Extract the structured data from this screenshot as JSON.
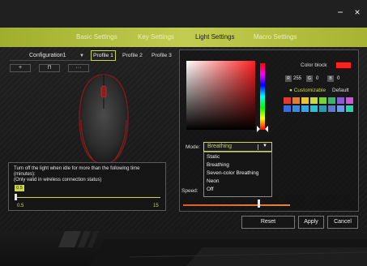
{
  "window": {
    "minimize_symbol": "−",
    "close_symbol": "×"
  },
  "nav": {
    "items": [
      {
        "label": "Basic Settings",
        "active": false
      },
      {
        "label": "Key Settings",
        "active": false
      },
      {
        "label": "Light Settings",
        "active": true
      },
      {
        "label": "Macro Settings",
        "active": false
      }
    ]
  },
  "config": {
    "value": "Configuration1",
    "arrow": "▼"
  },
  "profiles": [
    {
      "label": "Profile 1",
      "active": true
    },
    {
      "label": "Profile 2",
      "active": false
    },
    {
      "label": "Profile 3",
      "active": false
    }
  ],
  "small_buttons": [
    {
      "label": "+"
    },
    {
      "label": "⊓"
    },
    {
      "label": "···"
    }
  ],
  "idle": {
    "text": "Turn off the light when idle for more than the following time\n(minutes):\n(Only valid in wireless connection status)",
    "value": "0.5",
    "min_label": "0.5",
    "max_label": "15",
    "min": 0.5,
    "max": 15
  },
  "color": {
    "label": "Color block",
    "current": "#ff2020",
    "r_key": "R",
    "r": "255",
    "g_key": "G",
    "g": "0",
    "b_key": "B",
    "b": "0",
    "customizable_label": "● Customizable",
    "default_label": "Default",
    "swatch_rows": [
      [
        "#e23a2e",
        "#e8792e",
        "#e8c23a",
        "#c8d84a",
        "#7ad23a",
        "#3ab46a",
        "#8a5ad2",
        "#c85ad2"
      ],
      [
        "#3a6ae2",
        "#3a8ae2",
        "#3aa2e2",
        "#2ac2d2",
        "#2a9ab2",
        "#5a7ad2",
        "#6a9ae2",
        "#2ad2b2"
      ]
    ]
  },
  "mode": {
    "label": "Mode:",
    "selected": "Breathing",
    "arrow": "▼",
    "options": [
      "Static",
      "Breathing",
      "Seven-color Breathing",
      "Neon",
      "Off"
    ]
  },
  "speed": {
    "label": "Speed:",
    "level": 0.7
  },
  "actions": {
    "reset": "Reset",
    "apply": "Apply",
    "cancel": "Cancel"
  }
}
